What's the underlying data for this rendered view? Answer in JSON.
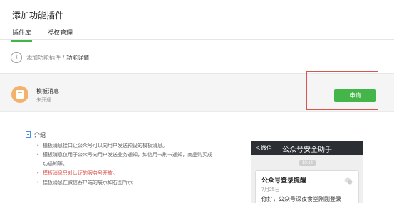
{
  "header": {
    "title": "添加功能插件"
  },
  "tabs": [
    {
      "label": "插件库",
      "active": true
    },
    {
      "label": "授权管理",
      "active": false
    }
  ],
  "breadcrumb": {
    "parent": "添加功能插件",
    "separator": "/",
    "current": "功能详情"
  },
  "plugin": {
    "name": "模板消息",
    "status": "未开通",
    "apply_label": "申请"
  },
  "intro": {
    "heading": "介绍",
    "items": [
      {
        "text": "模板消息接口让公众号可以向用户发送预设的模板消息。",
        "style": "normal"
      },
      {
        "text": "模板消息仅用于公众号向用户发送业务通知，如信用卡刷卡通知，商品购买成",
        "style": "normal"
      },
      {
        "text": "功通知等。",
        "style": "cont"
      },
      {
        "text": "模板消息只对认证的服务号开放。",
        "style": "red"
      },
      {
        "text": "模板消息在微信客户端的展示如右图所示",
        "style": "normal"
      }
    ]
  },
  "phone_preview": {
    "back_label": "＜微信",
    "title": "公众号安全助手",
    "time": "10:14",
    "card_title": "公众号登录提醒",
    "card_date": "7月25日",
    "card_body": "你好，公众号深夜食堂刚刚登录"
  },
  "colors": {
    "accent": "#44b549",
    "highlight_box": "#d9534f",
    "plugin_icon": "#f4b169"
  }
}
